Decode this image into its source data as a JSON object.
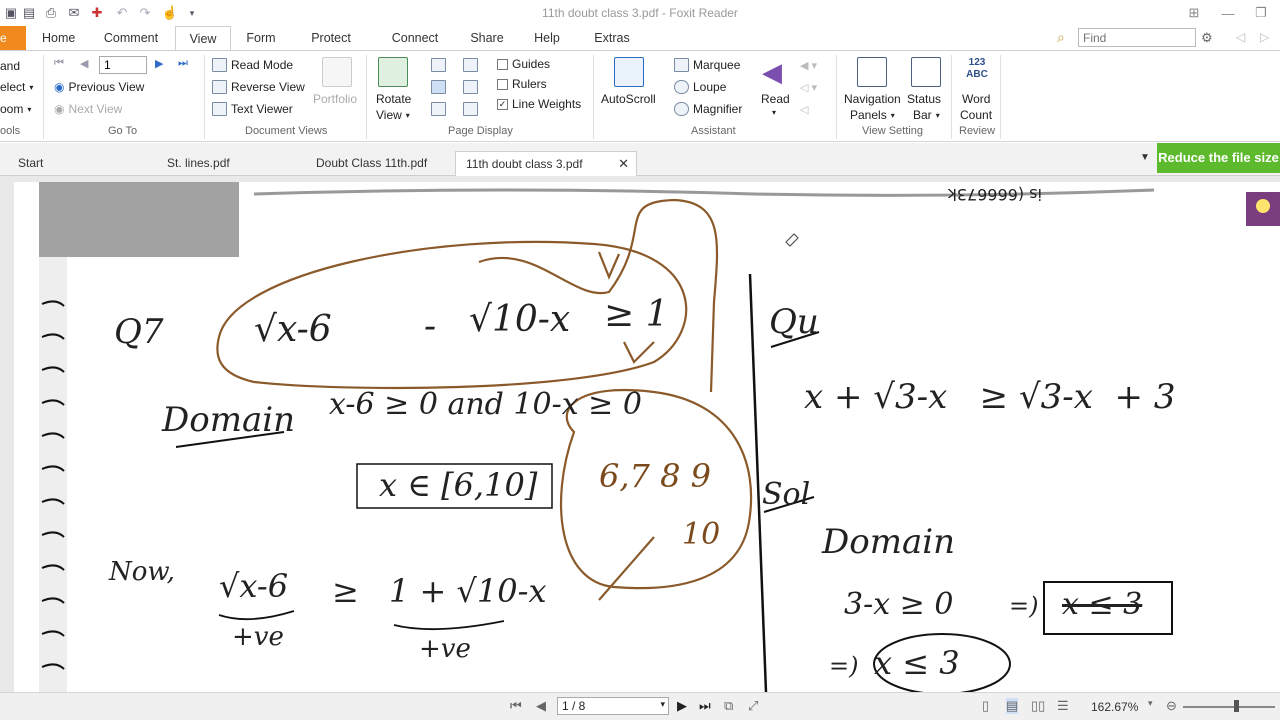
{
  "window": {
    "title": "11th doubt class 3.pdf - Foxit Reader"
  },
  "menu": {
    "file": "e",
    "items": [
      "Home",
      "Comment",
      "View",
      "Form",
      "Protect",
      "Connect",
      "Share",
      "Help",
      "Extras"
    ],
    "active": "View",
    "find_placeholder": "Find"
  },
  "ribbon": {
    "tools": {
      "hand": "and",
      "select": "elect",
      "zoom": "oom",
      "label": "ools"
    },
    "goto": {
      "page_value": "1",
      "previous_view": "Previous View",
      "next_view": "Next View",
      "label": "Go To"
    },
    "document_views": {
      "read_mode": "Read Mode",
      "reverse_view": "Reverse View",
      "text_viewer": "Text Viewer",
      "portfolio": "Portfolio",
      "label": "Document Views"
    },
    "page_display": {
      "rotate": "Rotate",
      "rotate2": "View",
      "guides": "Guides",
      "rulers": "Rulers",
      "line_weights": "Line Weights",
      "label": "Page Display"
    },
    "assistant": {
      "autoscroll": "AutoScroll",
      "marquee": "Marquee",
      "loupe": "Loupe",
      "magnifier": "Magnifier",
      "read": "Read",
      "label": "Assistant"
    },
    "view_setting": {
      "nav1": "Navigation",
      "nav2": "Panels",
      "status1": "Status",
      "status2": "Bar",
      "label": "View Setting"
    },
    "review": {
      "wc_icon": "123 ABC",
      "word": "Word",
      "count": "Count",
      "label": "Review"
    }
  },
  "tabs": [
    "Start",
    "St. lines.pdf",
    "Doubt Class 11th.pdf",
    "11th doubt class 3.pdf"
  ],
  "reduce_button": "Reduce the file size",
  "document": {
    "q_label": "Q7",
    "left_expr1": "√x-6",
    "left_expr2": "-",
    "left_expr3": "√10-x",
    "left_expr4": "≥ 1",
    "domain_label": "Domain",
    "domain_expr": "x-6 ≥ 0  and  10-x ≥ 0",
    "interval": "x ∈ [6,10]",
    "circle_nums": "6,7 8 9",
    "circle_ten": "10",
    "now_label": "Now,",
    "now_left": "√x-6",
    "now_ge": "≥",
    "now_right": "1 + √10-x",
    "pos1": "+ve",
    "pos2": "+ve",
    "right_q": "Qu",
    "right_eq": "x + √3-x   ≥ √3-x  + 3",
    "sol_label": "Sol",
    "right_domain": "Domain",
    "right_cond": "3-x ≥ 0",
    "right_impl": "=)",
    "right_boxed": "x ≤ 3",
    "right_impl2": "=)",
    "right_circled": "x ≤ 3",
    "top_mirror": "is (666673k"
  },
  "status": {
    "page": "1 / 8",
    "zoom": "162.67%"
  }
}
